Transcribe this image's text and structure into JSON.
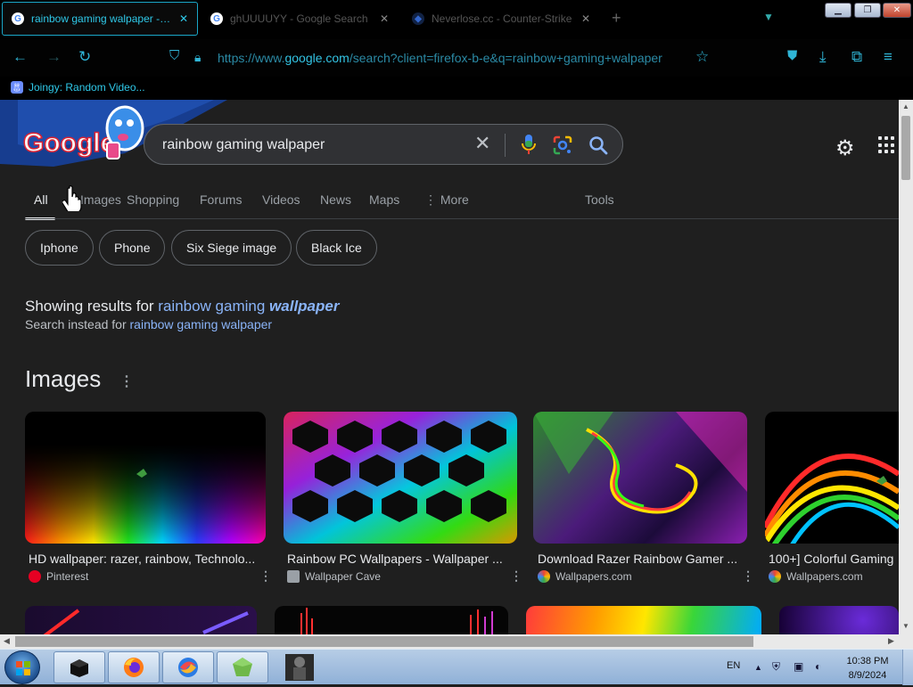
{
  "browser": {
    "tabs": [
      {
        "label": "rainbow gaming walpaper - Go",
        "active": true
      },
      {
        "label": "ghUUUUYY - Google Search",
        "active": false
      },
      {
        "label": "Neverlose.cc - Counter-Strike",
        "active": false
      }
    ],
    "url_prefix": "https://www.",
    "url_domain": "google.com",
    "url_rest": "/search?client=firefox-b-e&q=rainbow+gaming+walpaper",
    "bookmark": "Joingy: Random Video..."
  },
  "search": {
    "query": "rainbow gaming walpaper",
    "logo_text": "Google"
  },
  "tabs": [
    "All",
    "Images",
    "Shopping",
    "Forums",
    "Videos",
    "News",
    "Maps",
    "More",
    "Tools"
  ],
  "chips": [
    "Iphone",
    "Phone",
    "Six Siege image",
    "Black Ice"
  ],
  "correction": {
    "showing_prefix": "Showing results for ",
    "showing_link_plain": "rainbow gaming ",
    "showing_link_bold": "wallpaper",
    "instead_prefix": "Search instead for ",
    "instead_link": "rainbow gaming walpaper"
  },
  "images": {
    "heading": "Images",
    "cards": [
      {
        "title": "HD wallpaper: razer, rainbow, Technolo...",
        "source": "Pinterest",
        "source_color": "#e60023"
      },
      {
        "title": "Rainbow PC Wallpapers - Wallpaper ...",
        "source": "Wallpaper Cave",
        "source_color": "#9aa0a6"
      },
      {
        "title": "Download Razer Rainbow Gamer ...",
        "source": "Wallpapers.com",
        "source_color": "#f5c518"
      },
      {
        "title": "100+] Colorful Gaming",
        "source": "Wallpapers.com",
        "source_color": "#f5c518"
      }
    ]
  },
  "taskbar": {
    "lang": "EN",
    "time": "10:38 PM",
    "date": "8/9/2024"
  },
  "colors": {
    "accent": "#2fc8e8",
    "link": "#8ab4f8",
    "page_bg": "#1f1f1f"
  }
}
